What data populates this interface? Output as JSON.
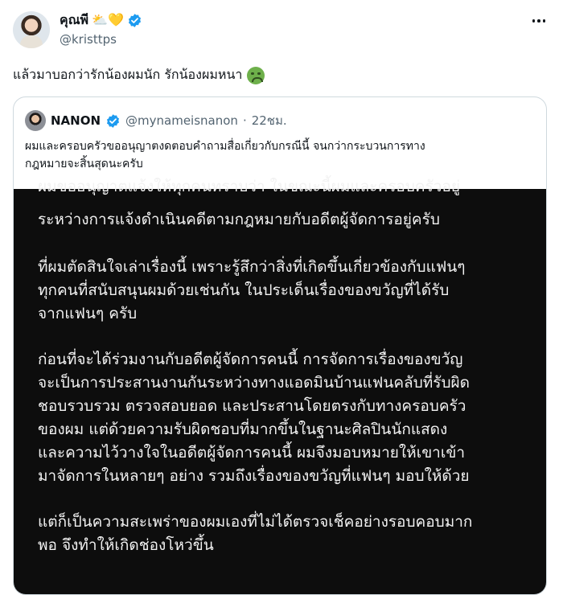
{
  "author": {
    "display_name": "คุณพี",
    "emojis": "⛅💛",
    "handle": "@kristtps"
  },
  "tweet": {
    "text": "แล้วมาบอกว่ารักน้องผมนัก รักน้องผมหนา",
    "emoji_icon": "sick-face-emoji"
  },
  "quoted": {
    "display_name": "NANON",
    "handle": "@mynameisnanon",
    "separator": "·",
    "time": "22ชม.",
    "text_lines": [
      "ผมและครอบครัวขออนุญาตงดตอบคำถามสื่อเกี่ยวกับกรณีนี้ จนกว่ากระบวนการทาง",
      "กฎหมายจะสิ้นสุดนะครับ"
    ]
  },
  "image_text": {
    "cut_line": "ผมขออนุญาตแจ้งให้ทุกคนทราบว่า ในขณะนี้ผมและครอบครัวอยู่",
    "paragraphs": [
      [
        "ระหว่างการแจ้งดำเนินคดีตามกฎหมายกับอดีตผู้จัดการอยู่ครับ"
      ],
      [
        "ที่ผมตัดสินใจเล่าเรื่องนี้ เพราะรู้สึกว่าสิ่งที่เกิดขึ้นเกี่ยวข้องกับแฟนๆ",
        "ทุกคนที่สนับสนุนผมด้วยเช่นกัน ในประเด็นเรื่องของขวัญที่ได้รับ",
        "จากแฟนๆ ครับ"
      ],
      [
        "ก่อนที่จะได้ร่วมงานกับอดีตผู้จัดการคนนี้ การจัดการเรื่องของขวัญ",
        "จะเป็นการประสานงานกันระหว่างทางแอดมินบ้านแฟนคลับที่รับผิด",
        "ชอบรวบรวม ตรวจสอบยอด และประสานโดยตรงกับทางครอบครัว",
        "ของผม แต่ด้วยความรับผิดชอบที่มากขึ้นในฐานะศิลปินนักแสดง",
        "และความไว้วางใจในอดีตผู้จัดการคนนี้  ผมจึงมอบหมายให้เขาเข้า",
        "มาจัดการในหลายๆ อย่าง รวมถึงเรื่องของขวัญที่แฟนๆ มอบให้ด้วย"
      ],
      [
        "แต่ก็เป็นความสะเพร่าของผมเองที่ไม่ได้ตรวจเช็คอย่างรอบคอบมาก",
        "พอ จึงทำให้เกิดช่องโหว่ขึ้น"
      ]
    ]
  },
  "colors": {
    "verified": "#1d9bf0",
    "secondary_text": "#536471",
    "image_bg": "#0d0d0d"
  }
}
